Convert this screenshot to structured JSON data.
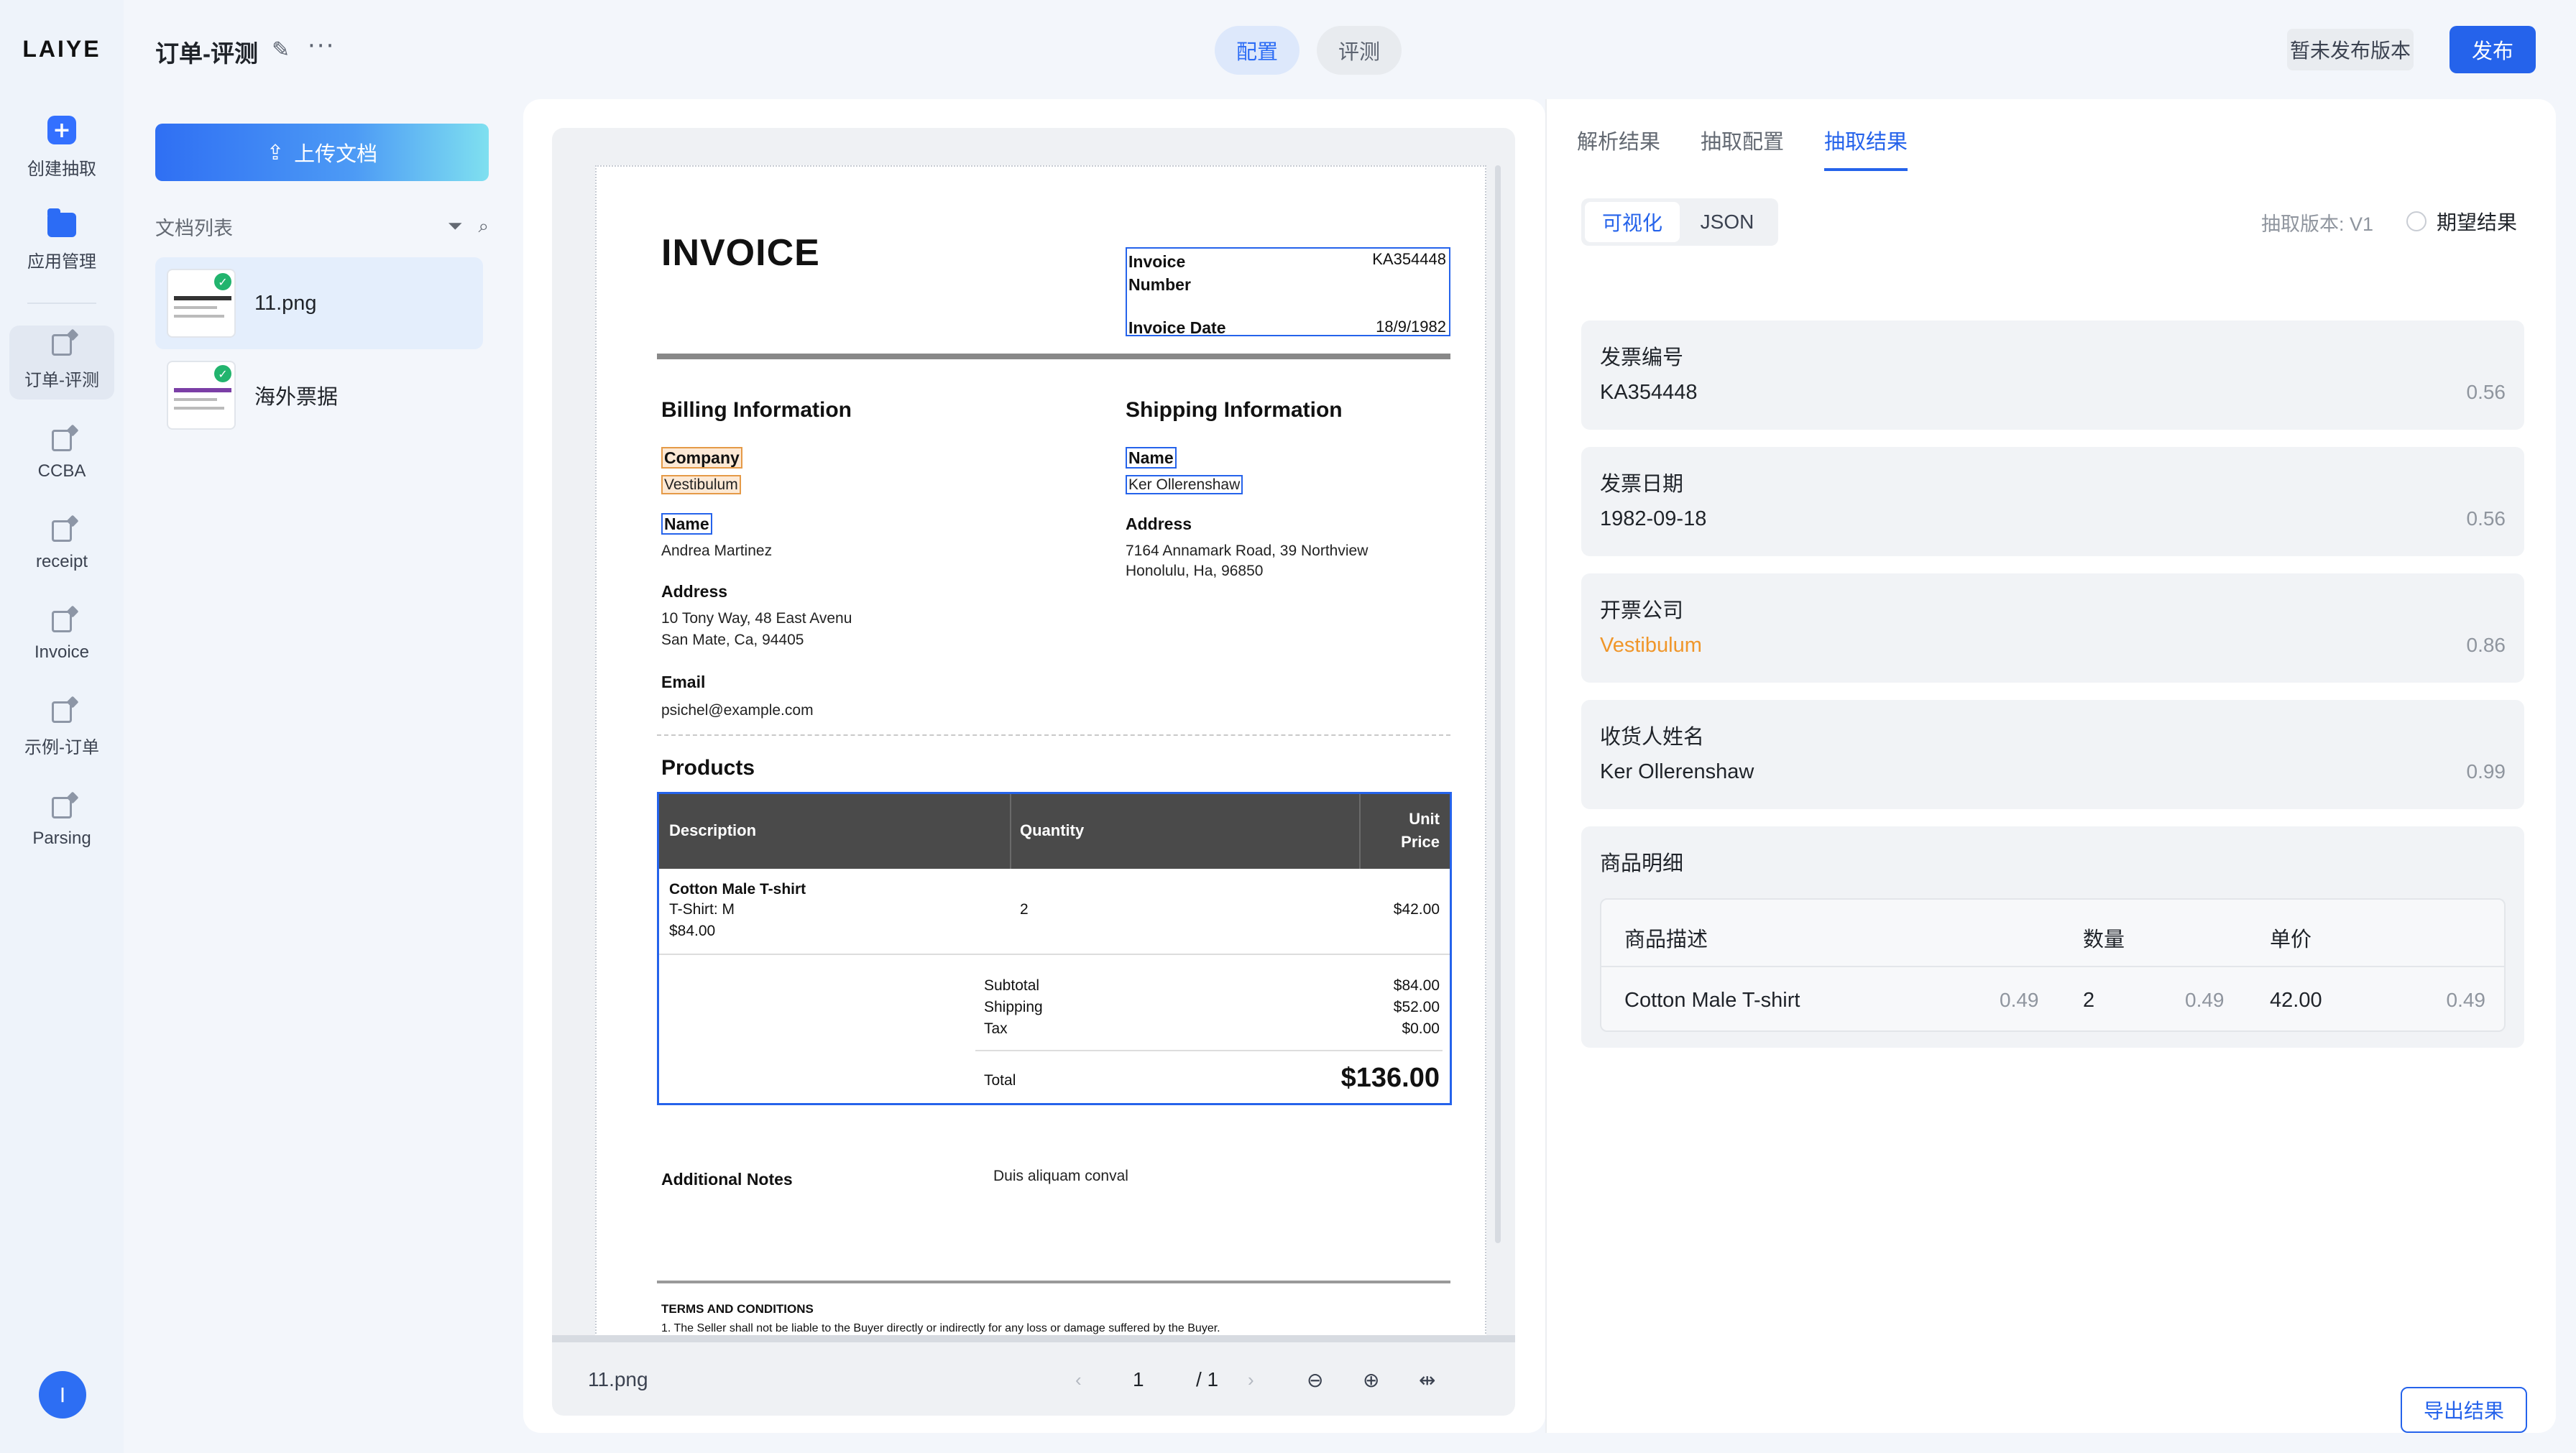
{
  "sidebar": {
    "logo": "LAIYE",
    "items": [
      {
        "label": "创建抽取",
        "icon": "plus-icon"
      },
      {
        "label": "应用管理",
        "icon": "folder-icon"
      },
      {
        "label": "订单-评测",
        "icon": "doc-edit-icon",
        "active": true
      },
      {
        "label": "CCBA",
        "icon": "doc-edit-icon"
      },
      {
        "label": "receipt",
        "icon": "doc-edit-icon"
      },
      {
        "label": "Invoice",
        "icon": "doc-edit-icon"
      },
      {
        "label": "示例-订单",
        "icon": "doc-edit-icon"
      },
      {
        "label": "Parsing",
        "icon": "doc-edit-icon"
      }
    ],
    "avatar_initial": "I"
  },
  "header": {
    "title": "订单-评测",
    "tabs": [
      "配置",
      "评测"
    ],
    "version_button": "暂未发布版本",
    "publish_button": "发布"
  },
  "doclist": {
    "upload_button": "上传文档",
    "list_title": "文档列表",
    "files": [
      {
        "name": "11.png",
        "status": "done",
        "selected": true
      },
      {
        "name": "海外票据",
        "status": "done",
        "selected": false
      }
    ]
  },
  "viewer": {
    "file_name": "11.png",
    "page_current": "1",
    "page_total": "/ 1",
    "invoice": {
      "title": "INVOICE",
      "number_label": "Invoice Number",
      "number_label_line1": "Invoice",
      "number_label_line2": "Number",
      "number_value": "KA354448",
      "date_label": "Invoice Date",
      "date_value": "18/9/1982",
      "billing_title": "Billing Information",
      "shipping_title": "Shipping Information",
      "billing": {
        "company_label": "Company",
        "company_value": "Vestibulum",
        "name_label": "Name",
        "name_value": "Andrea Martinez",
        "address_label": "Address",
        "address_line1": "10 Tony Way, 48 East Avenu",
        "address_line2": "San Mate, Ca, 94405",
        "email_label": "Email",
        "email_value": "psichel@example.com"
      },
      "shipping": {
        "name_label": "Name",
        "name_value": "Ker Ollerenshaw",
        "address_label": "Address",
        "address_line1": "7164 Annamark Road, 39 Northview",
        "address_line2": "Honolulu, Ha, 96850"
      },
      "products_title": "Products",
      "columns": [
        "Description",
        "Quantity",
        "Unit",
        "Price"
      ],
      "item": {
        "name": "Cotton Male T-shirt",
        "variant": "T-Shirt: M",
        "line_total": "$84.00",
        "quantity": "2",
        "unit_price": "$42.00"
      },
      "subtotal_label": "Subtotal",
      "subtotal_value": "$84.00",
      "shipping_label": "Shipping",
      "shipping_value": "$52.00",
      "tax_label": "Tax",
      "tax_value": "$0.00",
      "total_label": "Total",
      "total_value": "$136.00",
      "notes_label": "Additional Notes",
      "notes_value": "Duis aliquam conval",
      "terms_title": "TERMS AND CONDITIONS",
      "terms_text": "1. The Seller shall not be liable to the Buyer directly or indirectly for any loss or damage suffered by the Buyer."
    }
  },
  "result": {
    "tabs": [
      "解析结果",
      "抽取配置",
      "抽取结果"
    ],
    "active_tab": "抽取结果",
    "view_toggle": [
      "可视化",
      "JSON"
    ],
    "version": "抽取版本: V1",
    "expected_label": "期望结果",
    "fields": [
      {
        "key": "发票编号",
        "value": "KA354448",
        "score": "0.56"
      },
      {
        "key": "发票日期",
        "value": "1982-09-18",
        "score": "0.56"
      },
      {
        "key": "开票公司",
        "value": "Vestibulum",
        "score": "0.86"
      },
      {
        "key": "收货人姓名",
        "value": "Ker Ollerenshaw",
        "score": "0.99"
      }
    ],
    "products": {
      "title": "商品明细",
      "headers": [
        "商品描述",
        "数量",
        "单价"
      ],
      "row": {
        "desc": "Cotton Male T-shirt",
        "desc_score": "0.49",
        "qty": "2",
        "qty_score": "0.49",
        "price": "42.00",
        "price_score": "0.49"
      }
    },
    "export_button": "导出结果"
  },
  "colors": {
    "accent": "#2563eb",
    "highlight_orange": "#f0962a",
    "success": "#22b46e"
  }
}
